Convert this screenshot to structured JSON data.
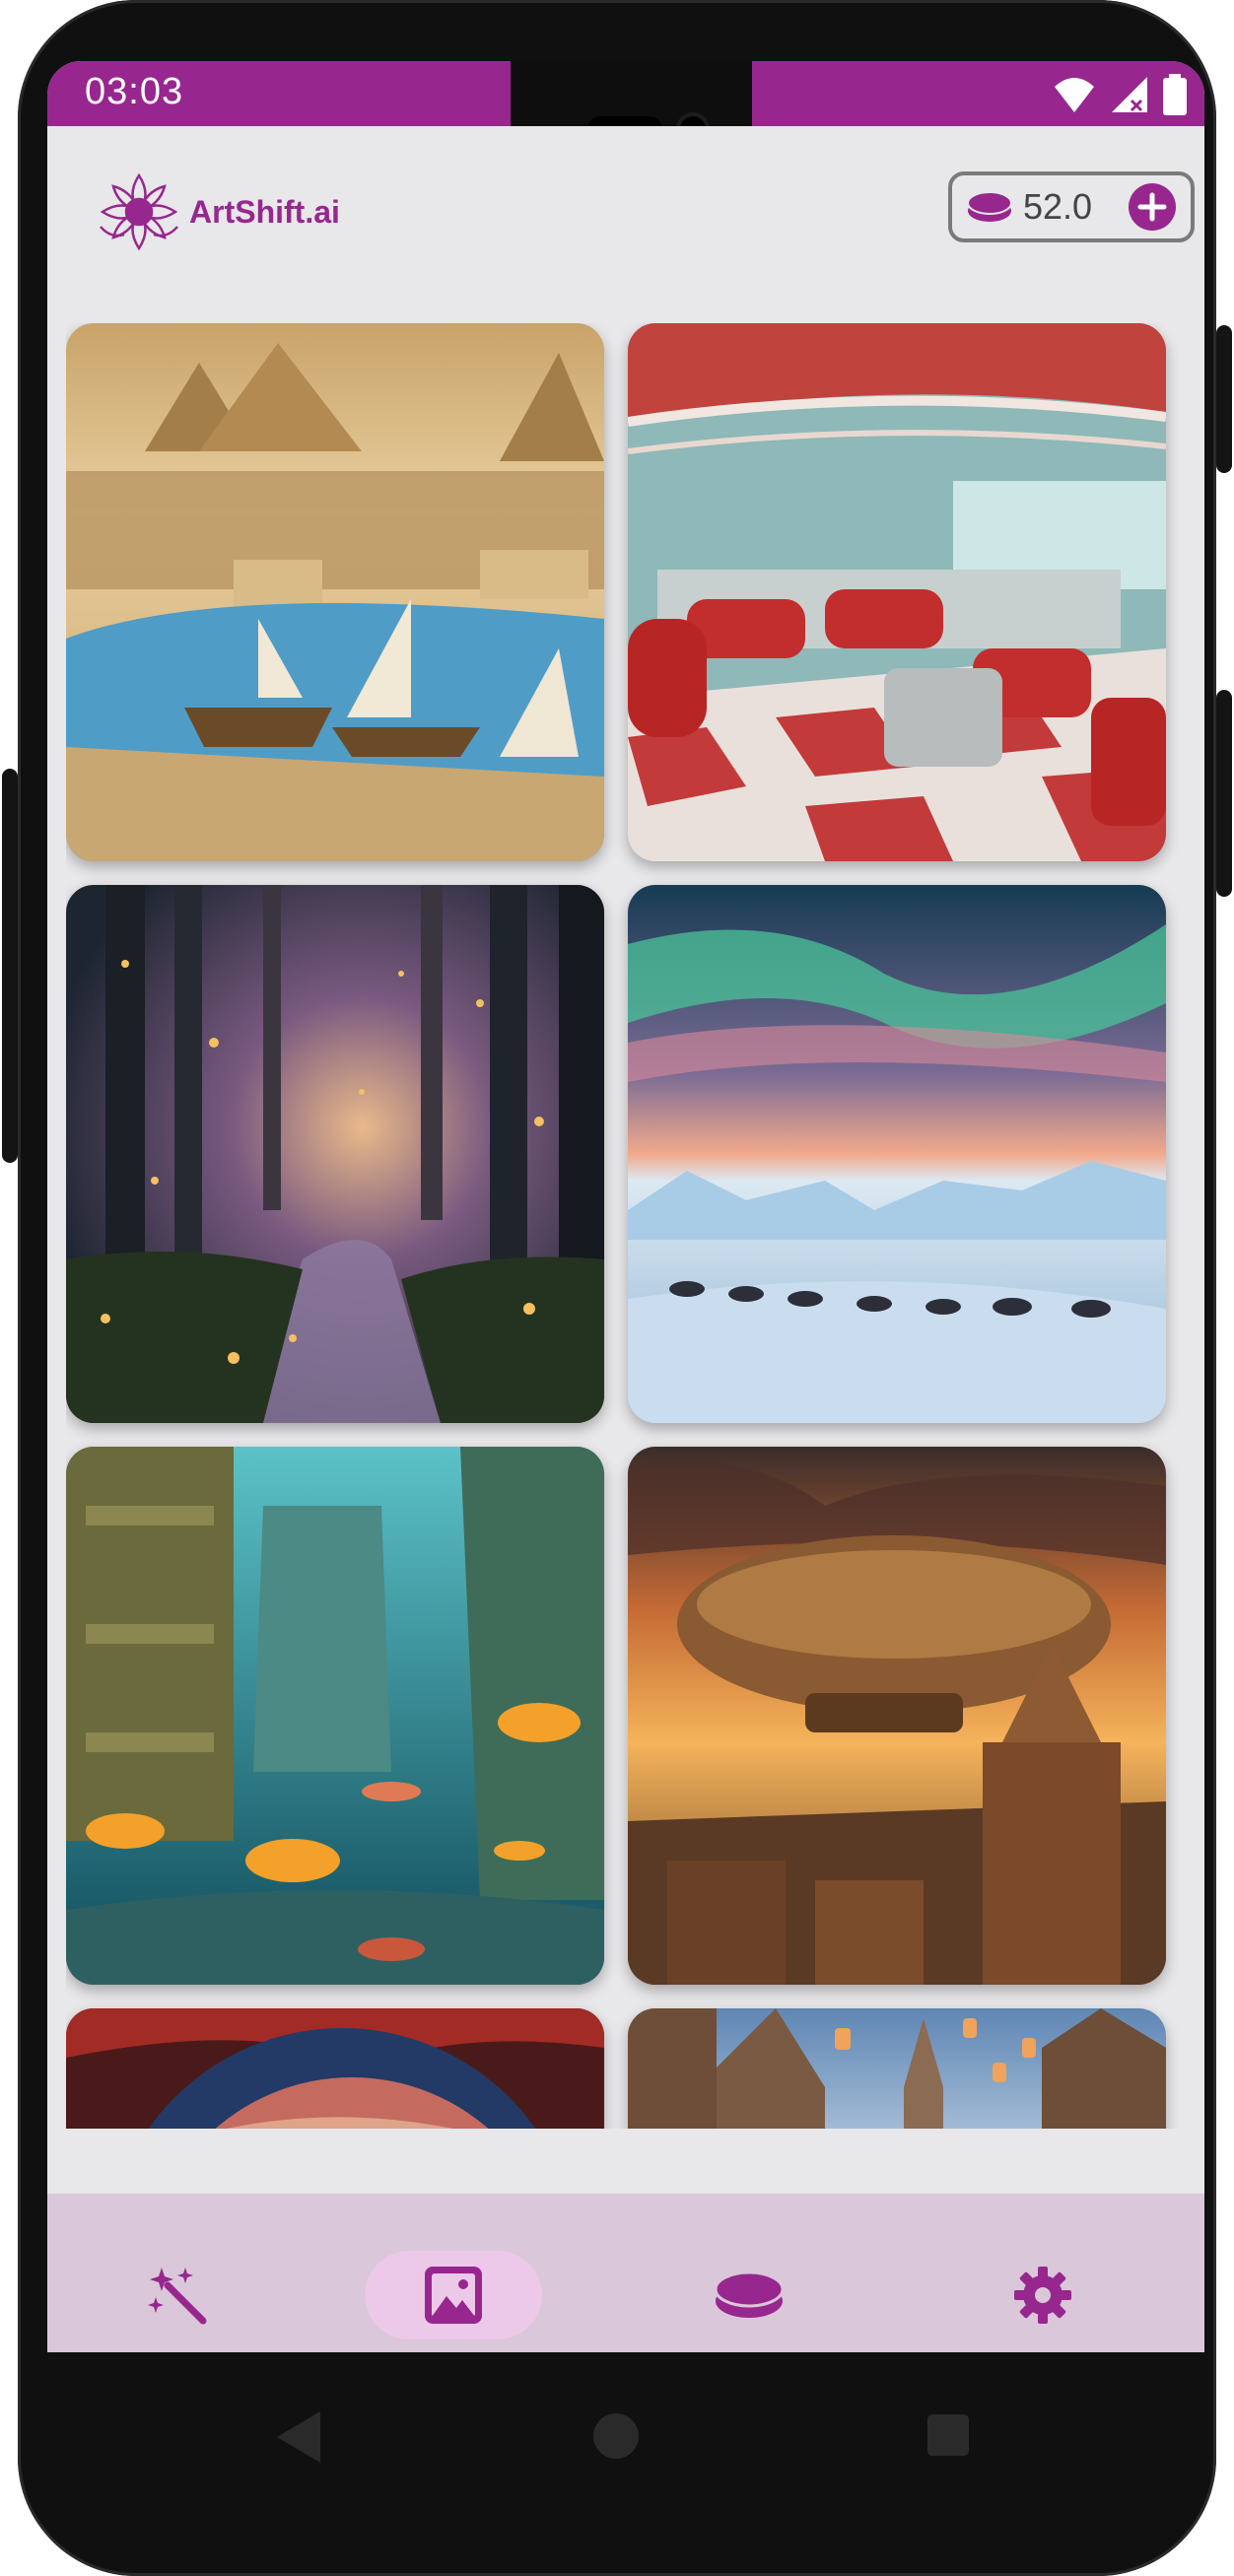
{
  "status_bar": {
    "time": "03:03",
    "icons": [
      "wifi-icon",
      "signal-icon",
      "battery-icon"
    ]
  },
  "header": {
    "app_name": "ArtShift.ai",
    "credits": "52.0",
    "icons": {
      "credits": "coin-stack-icon",
      "add": "plus-circle-icon"
    }
  },
  "gallery": {
    "tiles": [
      {
        "name": "tile-egypt-pyramids-nile",
        "icon": "image-thumbnail"
      },
      {
        "name": "tile-retro-diner",
        "icon": "image-thumbnail"
      },
      {
        "name": "tile-enchanted-forest",
        "icon": "image-thumbnail"
      },
      {
        "name": "tile-aurora-sled-dogs",
        "icon": "image-thumbnail"
      },
      {
        "name": "tile-underwater-ruins",
        "icon": "image-thumbnail"
      },
      {
        "name": "tile-steampunk-airship",
        "icon": "image-thumbnail"
      },
      {
        "name": "tile-space-planet",
        "icon": "image-thumbnail"
      },
      {
        "name": "tile-lantern-village",
        "icon": "image-thumbnail"
      }
    ]
  },
  "bottom_nav": {
    "active": "gallery",
    "items": [
      {
        "id": "create",
        "icon": "magic-wand-icon"
      },
      {
        "id": "gallery",
        "icon": "image-icon"
      },
      {
        "id": "credits",
        "icon": "coin-icon"
      },
      {
        "id": "settings",
        "icon": "gear-icon"
      }
    ]
  },
  "colors": {
    "brand": "#97278f",
    "background": "#e8e7e9",
    "nav_background": "#dac7d9",
    "nav_active": "#ecc9e8"
  }
}
